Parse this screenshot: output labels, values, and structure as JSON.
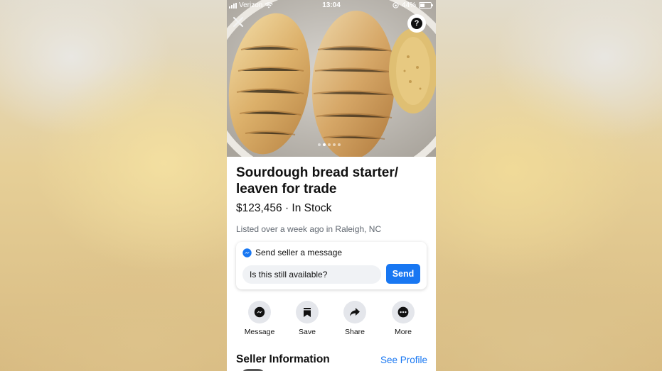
{
  "status_bar": {
    "carrier": "Verizon",
    "time": "13:04",
    "battery": "44%",
    "battery_level": 0.44
  },
  "photo": {
    "pager_count": 5,
    "pager_active": 1
  },
  "listing": {
    "title": "Sourdough bread starter/ leaven for trade",
    "price_stock": "$123,456 · In Stock",
    "listed": "Listed over a week ago in Raleigh, NC"
  },
  "message_card": {
    "heading": "Send seller a message",
    "input_value": "Is this still available?",
    "send_label": "Send"
  },
  "actions": [
    {
      "label": "Message",
      "icon": "messenger-icon"
    },
    {
      "label": "Save",
      "icon": "bookmark-icon"
    },
    {
      "label": "Share",
      "icon": "share-icon"
    },
    {
      "label": "More",
      "icon": "more-icon"
    }
  ],
  "seller": {
    "heading": "Seller Information",
    "see_profile": "See Profile"
  },
  "colors": {
    "accent": "#1877f2",
    "secondary_text": "#606770",
    "chip_bg": "#e4e6eb"
  }
}
